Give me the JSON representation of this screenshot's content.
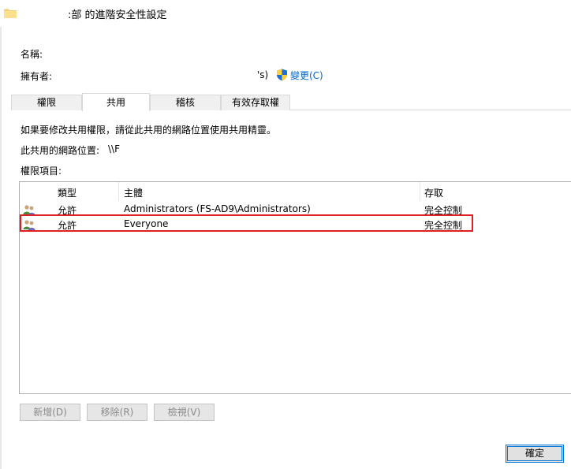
{
  "window": {
    "title": ":部 的進階安全性設定"
  },
  "info": {
    "name_label": "名稱:",
    "owner_label": "擁有者:",
    "owner_suffix": "'s)",
    "change_link": "變更(C)"
  },
  "tabs": [
    {
      "label": "權限"
    },
    {
      "label": "共用"
    },
    {
      "label": "稽核"
    },
    {
      "label": "有效存取權"
    }
  ],
  "share": {
    "instruction": "如果要修改共用權限，請從此共用的網路位置使用共用精靈。",
    "location_label": "此共用的網路位置:",
    "location_value": "\\\\F",
    "entries_label": "權限項目:"
  },
  "table": {
    "columns": [
      "類型",
      "主體",
      "存取"
    ],
    "rows": [
      {
        "type": "允許",
        "principal": "Administrators (FS-AD9\\Administrators)",
        "access": "完全控制"
      },
      {
        "type": "允許",
        "principal": "Everyone",
        "access": "完全控制"
      }
    ]
  },
  "buttons": {
    "add": "新增(D)",
    "remove": "移除(R)",
    "view": "檢視(V)",
    "ok": "確定"
  },
  "icons": {
    "window": "folder-icon",
    "uac": "uac-shield-icon",
    "principal": "users-icon"
  }
}
